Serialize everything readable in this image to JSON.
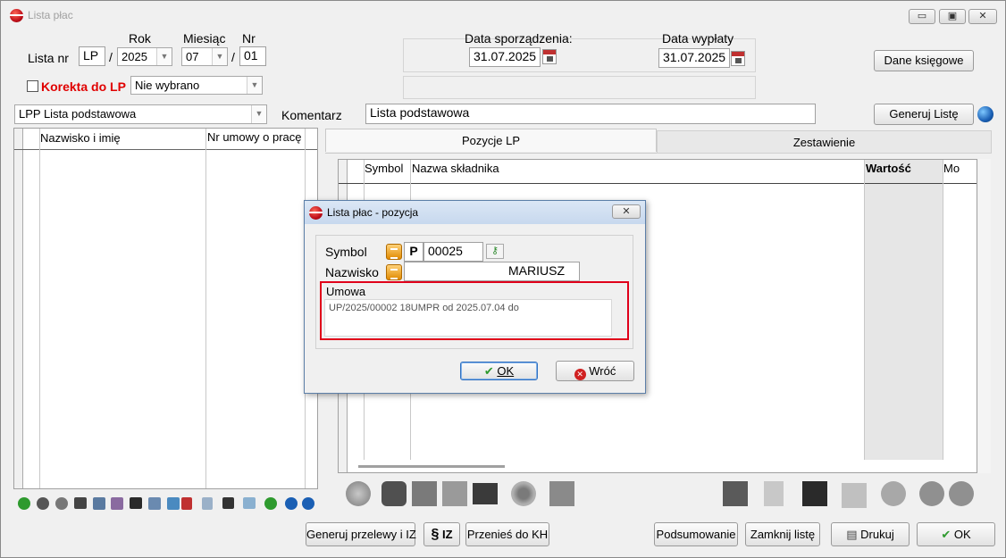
{
  "window": {
    "title": "Lista płac",
    "min": "▭",
    "max": "▣",
    "close": "✕"
  },
  "header": {
    "lista_nr_label": "Lista nr",
    "rok_label": "Rok",
    "miesiac_label": "Miesiąc",
    "nr_label": "Nr",
    "lp_value": "LP",
    "rok_value": "2025",
    "miesiac_value": "07",
    "nr_value": "01",
    "slash": "/",
    "korekta_label": "Korekta  do LP",
    "korekta_value": "Nie wybrano",
    "data_sporzadzenia_label": "Data sporządzenia:",
    "data_sporzadzenia_value": "31.07.2025",
    "data_wyplaty_label": "Data wypłaty",
    "data_wyplaty_value": "31.07.2025",
    "dane_ksiegowe": "Dane księgowe",
    "lpp_value": "LPP Lista podstawowa",
    "komentarz_label": "Komentarz",
    "komentarz_value": "Lista podstawowa",
    "generuj_liste": "Generuj Listę"
  },
  "left_grid": {
    "columns": [
      "Nazwisko i imię",
      "Nr umowy o pracę"
    ]
  },
  "tabs": [
    "Pozycje LP",
    "Zestawienie"
  ],
  "right_grid": {
    "columns": [
      "Symbol",
      "Nazwa składnika",
      "Wartość",
      "Mo"
    ]
  },
  "bottom_buttons": {
    "generuj_przelewy": "Generuj przelewy i IZ",
    "iz": "IZ",
    "przenies": "Przenieś do KH",
    "podsumowanie": "Podsumowanie",
    "zamknij": "Zamknij listę",
    "drukuj": "Drukuj",
    "ok": "OK"
  },
  "dialog": {
    "title": "Lista płac - pozycja",
    "close": "✕",
    "symbol_label": "Symbol",
    "symbol_prefix": "P",
    "symbol_value": "00025",
    "nazwisko_label": "Nazwisko",
    "nazwisko_value": "MARIUSZ",
    "umowa_label": "Umowa",
    "umowa_value": "UP/2025/00002   18UMPR  od 2025.07.04 do",
    "ok": "OK",
    "wroc": "Wróć"
  },
  "colors": {
    "highlight_red": "#e0001a",
    "korekta_red": "#e00000",
    "accent_blue": "#1a5fb4"
  }
}
